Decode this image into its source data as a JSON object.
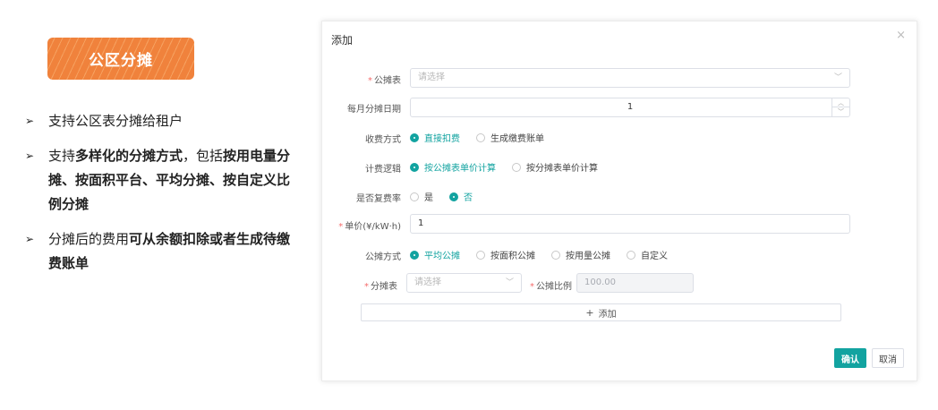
{
  "left_panel": {
    "badge": "公区分摊",
    "bullets": [
      {
        "parts": [
          {
            "text": "支持公区表分摊给租户",
            "bold": false
          }
        ]
      },
      {
        "parts": [
          {
            "text": "支持",
            "bold": false
          },
          {
            "text": "多样化的分摊方式",
            "bold": true
          },
          {
            "text": "，包括",
            "bold": false
          },
          {
            "text": "按用电量分摊、按面积平台、平均分摊、按自定义比例分摊",
            "bold": true
          }
        ]
      },
      {
        "parts": [
          {
            "text": "分摊后的费用",
            "bold": false
          },
          {
            "text": "可从余额扣除或者生成待缴费账单",
            "bold": true
          }
        ]
      }
    ]
  },
  "dialog": {
    "title": "添加",
    "close_glyph": "×",
    "fields": {
      "meter_table": {
        "label": "公摊表",
        "placeholder": "请选择"
      },
      "monthly_day": {
        "label": "每月分摊日期",
        "value": "1"
      },
      "charge_method": {
        "label": "收费方式",
        "options": [
          "直接扣费",
          "生成缴费账单"
        ],
        "selected": 0
      },
      "billing_logic": {
        "label": "计费逻辑",
        "options": [
          "按公摊表单价计算",
          "按分摊表单价计算"
        ],
        "selected": 0
      },
      "multi_rate": {
        "label": "是否复费率",
        "options": [
          "是",
          "否"
        ],
        "selected": 1
      },
      "unit_price": {
        "label": "单价(¥/kW·h)",
        "value": "1"
      },
      "share_method": {
        "label": "公摊方式",
        "options": [
          "平均公摊",
          "按面积公摊",
          "按用量公摊",
          "自定义"
        ],
        "selected": 0
      },
      "share_meter": {
        "label": "分摊表",
        "placeholder": "请选择"
      },
      "share_ratio": {
        "label": "公摊比例",
        "value": "100.00"
      }
    },
    "add_row_label": "添加",
    "confirm_label": "确认",
    "cancel_label": "取消"
  },
  "colors": {
    "accent": "#12a3a0",
    "badge": "#f0823c",
    "required": "#f56c6c"
  }
}
